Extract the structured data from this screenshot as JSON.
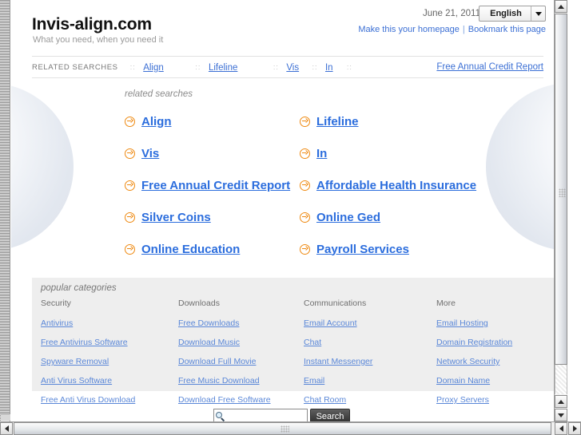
{
  "header": {
    "site_title": "Invis-align.com",
    "tagline": "What you need, when you need it",
    "date": "June 21, 2011",
    "language": "English",
    "homepage_link": "Make this your homepage",
    "bookmark_link": "Bookmark this page",
    "link_divider": "|"
  },
  "related_strip": {
    "label": "RELATED SEARCHES",
    "separator": "::",
    "links": [
      "Align",
      "Lifeline",
      "Vis",
      "In"
    ],
    "tail_link": "Free Annual Credit Report"
  },
  "main": {
    "heading": "related searches",
    "links": [
      "Align",
      "Lifeline",
      "Vis",
      "In",
      "Free Annual Credit Report",
      "Affordable Health Insurance",
      "Silver Coins",
      "Online Ged",
      "Online Education",
      "Payroll Services"
    ]
  },
  "categories": {
    "heading": "popular categories",
    "columns": [
      {
        "title": "Security",
        "items": [
          "Antivirus",
          "Free Antivirus Software",
          "Spyware Removal",
          "Anti Virus Software",
          "Free Anti Virus Download"
        ]
      },
      {
        "title": "Downloads",
        "items": [
          "Free Downloads",
          "Download Music",
          "Download Full Movie",
          "Free Music Download",
          "Download Free Software"
        ]
      },
      {
        "title": "Communications",
        "items": [
          "Email Account",
          "Chat",
          "Instant Messenger",
          "Email",
          "Chat Room"
        ]
      },
      {
        "title": "More",
        "items": [
          "Email Hosting",
          "Domain Registration",
          "Network Security",
          "Domain Name",
          "Proxy Servers"
        ]
      }
    ]
  },
  "search": {
    "value": "",
    "placeholder": "",
    "button_label": "Search",
    "icon": "search-icon"
  },
  "colors": {
    "link_blue": "#3b6fd4",
    "main_link_blue": "#2b6ddd",
    "cat_link_blue": "#5a87d8",
    "arrow_orange": "#ef8a12",
    "panel_gray": "#eeeeee",
    "button_dark": "#3b3b3b"
  }
}
